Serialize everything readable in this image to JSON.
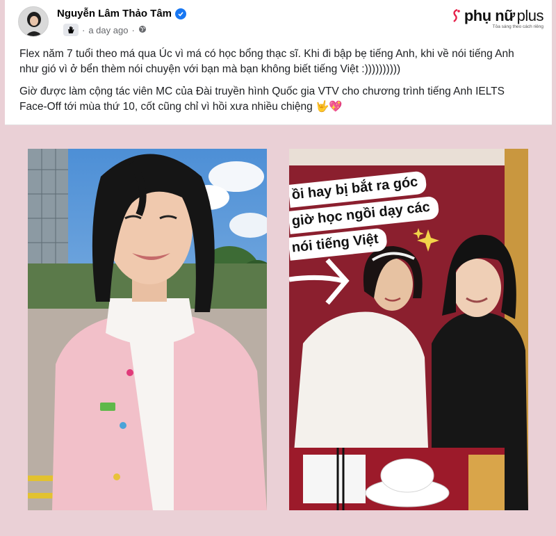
{
  "post": {
    "author": "Nguyễn Lâm Thảo Tâm",
    "time": "a day ago",
    "time_separator": "·",
    "paragraph_1": "Flex năm 7 tuổi theo má qua Úc vì má có học bổng thạc sĩ. Khi đi bập bẹ tiếng Anh, khi về nói tiếng Anh như gió vì ở bển thèm nói chuyện với bạn mà bạn không biết tiếng Việt :))))))))))",
    "paragraph_2": "Giờ được làm cộng tác viên MC của Đài truyền hình Quốc gia VTV cho chương trình tiếng Anh IELTS Face-Off tới mùa thứ 10, cốt cũng chỉ vì hồi xưa nhiều chiệng 🤟💖"
  },
  "brand": {
    "name_part1": "phụ nữ",
    "name_part2": "plus",
    "tagline": "Tỏa sáng theo cách riêng"
  },
  "photo_right": {
    "sticker_lines": [
      "ồi hay bị bắt ra góc",
      "giờ học ngồi dạy các",
      "nói tiếng Việt"
    ]
  },
  "colors": {
    "background": "#ead0d6",
    "verified_blue": "#1877f2",
    "cardigan_pink": "#f2c0c9"
  }
}
